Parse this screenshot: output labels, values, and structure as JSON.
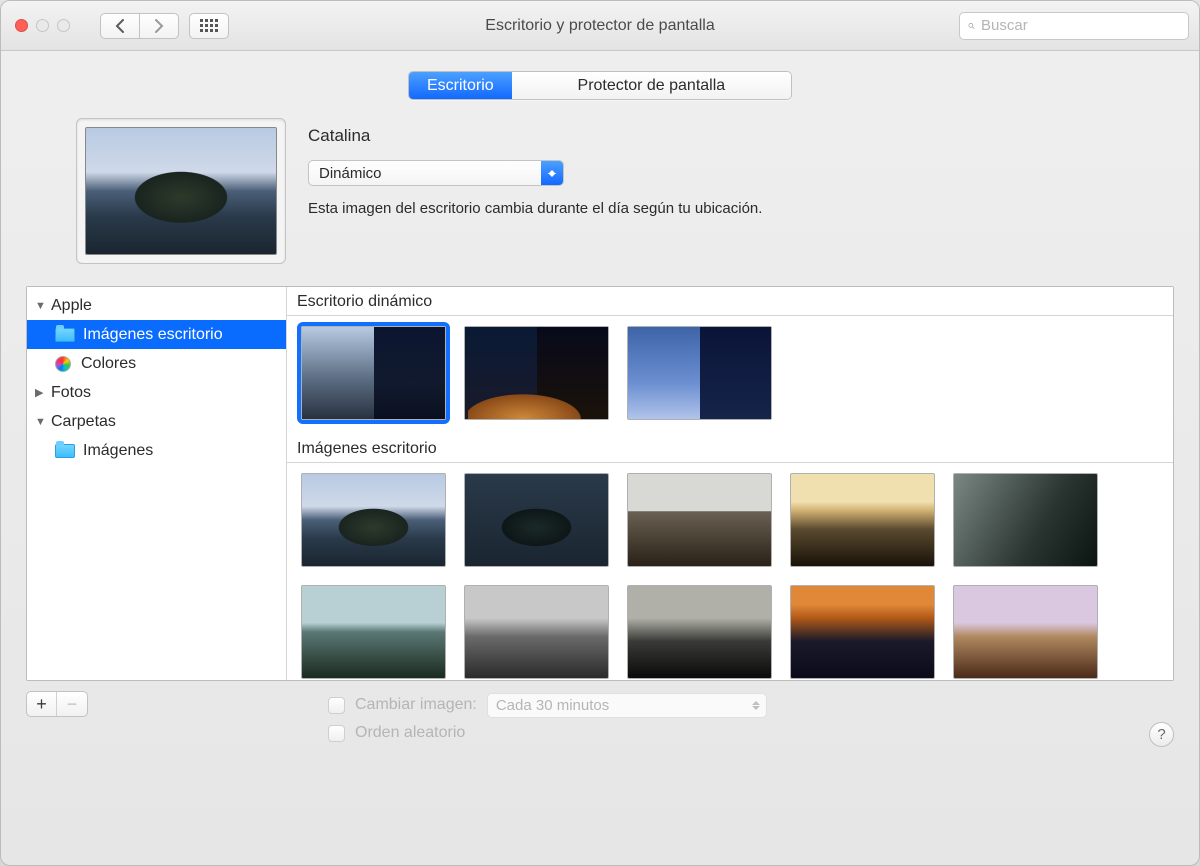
{
  "window": {
    "title": "Escritorio y protector de pantalla"
  },
  "search": {
    "placeholder": "Buscar"
  },
  "tabs": {
    "active": "Escritorio",
    "inactive": "Protector de pantalla"
  },
  "current": {
    "name": "Catalina",
    "mode_selected": "Dinámico",
    "description": "Esta imagen del escritorio cambia durante el día según tu ubicación."
  },
  "sidebar": {
    "apple": "Apple",
    "desktop_pictures": "Imágenes escritorio",
    "colors": "Colores",
    "photos": "Fotos",
    "folders": "Carpetas",
    "images": "Imágenes"
  },
  "sections": {
    "dynamic": "Escritorio dinámico",
    "pictures": "Imágenes escritorio"
  },
  "options": {
    "change_image": "Cambiar imagen:",
    "interval": "Cada 30 minutos",
    "random": "Orden aleatorio"
  },
  "help": "?"
}
